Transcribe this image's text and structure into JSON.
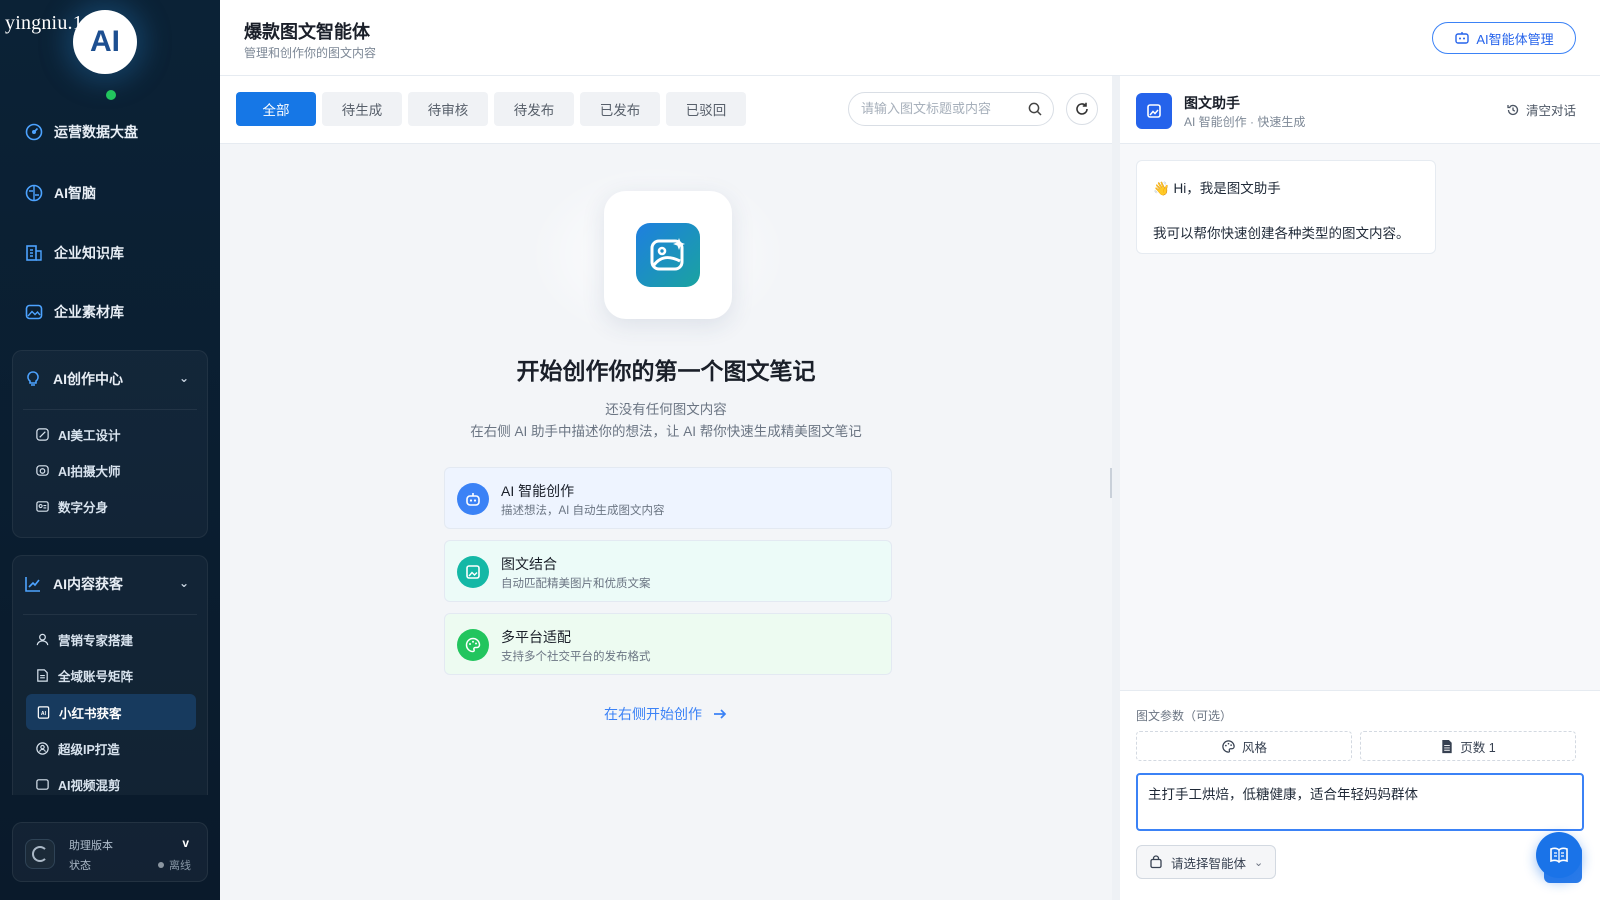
{
  "watermark": "yingniu.10v.co",
  "logo": {
    "text": "AI"
  },
  "sidebar": {
    "main_items": [
      {
        "label": "运营数据大盘",
        "icon": "dashboard-icon"
      },
      {
        "label": "AI智脑",
        "icon": "brain-icon"
      },
      {
        "label": "企业知识库",
        "icon": "knowledge-base-icon"
      },
      {
        "label": "企业素材库",
        "icon": "image-library-icon"
      }
    ],
    "groups": [
      {
        "title": "AI创作中心",
        "icon": "lightbulb-icon",
        "items": [
          {
            "label": "AI美工设计",
            "icon": "design-icon"
          },
          {
            "label": "AI拍摄大师",
            "icon": "camera-icon"
          },
          {
            "label": "数字分身",
            "icon": "id-card-icon"
          }
        ]
      },
      {
        "title": "AI内容获客",
        "icon": "trend-chart-icon",
        "items": [
          {
            "label": "营销专家搭建",
            "icon": "user-icon"
          },
          {
            "label": "全域账号矩阵",
            "icon": "document-icon"
          },
          {
            "label": "小红书获客",
            "icon": "ai-document-icon",
            "active": true
          },
          {
            "label": "超级IP打造",
            "icon": "badge-user-icon"
          },
          {
            "label": "AI视频混剪",
            "icon": "video-icon"
          }
        ]
      }
    ],
    "footer": {
      "version_label": "助理版本",
      "version_value": "v",
      "status_label": "状态",
      "status_value": "离线"
    }
  },
  "header": {
    "title": "爆款图文智能体",
    "subtitle": "管理和创作你的图文内容",
    "manage_button": "AI智能体管理"
  },
  "toolbar": {
    "tabs": [
      "全部",
      "待生成",
      "待审核",
      "待发布",
      "已发布",
      "已驳回"
    ],
    "active_tab": "全部",
    "search_placeholder": "请输入图文标题或内容"
  },
  "empty_state": {
    "title": "开始创作你的第一个图文笔记",
    "subtitle_1": "还没有任何图文内容",
    "subtitle_2": "在右侧 AI 助手中描述你的想法，让 AI 帮你快速生成精美图文笔记",
    "features": [
      {
        "title": "AI 智能创作",
        "desc": "描述想法，AI 自动生成图文内容",
        "icon": "robot-icon",
        "color": "#3b82f6",
        "bg": "#eef4ff"
      },
      {
        "title": "图文结合",
        "desc": "自动匹配精美图片和优质文案",
        "icon": "image-icon",
        "color": "#14b8a6",
        "bg": "#ecfbf8"
      },
      {
        "title": "多平台适配",
        "desc": "支持多个社交平台的发布格式",
        "icon": "palette-icon",
        "color": "#22c55e",
        "bg": "#edfbf1"
      }
    ],
    "start_link": "在右侧开始创作"
  },
  "assistant": {
    "name": "图文助手",
    "tagline": "AI 智能创作 · 快速生成",
    "clear_label": "清空对话",
    "greeting": "👋 Hi，我是图文助手",
    "message": "我可以帮你快速创建各种类型的图文内容。",
    "params_label": "图文参数（可选）",
    "style_button": "风格",
    "pages_button": "页数 1",
    "prompt_value": "主打手工烘焙，低糖健康，适合年轻妈妈群体",
    "agent_select": "请选择智能体"
  },
  "colors": {
    "accent": "#1677e6",
    "sidebar_bg": "#0b2236",
    "online": "#22c55e"
  }
}
